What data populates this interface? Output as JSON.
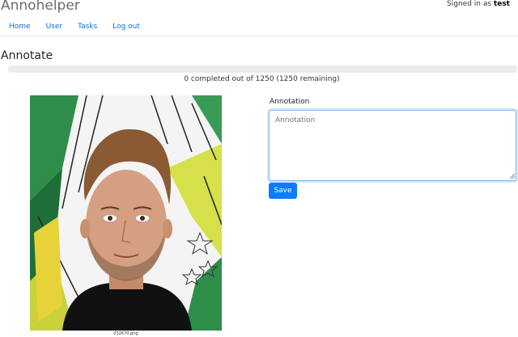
{
  "app": {
    "brand": "Annohelper"
  },
  "user": {
    "signed_in_prefix": "Signed in as",
    "username": "test"
  },
  "nav": {
    "items": [
      {
        "label": "Home"
      },
      {
        "label": "User"
      },
      {
        "label": "Tasks"
      },
      {
        "label": "Log out"
      }
    ]
  },
  "page": {
    "title": "Annotate"
  },
  "progress": {
    "completed": 0,
    "total": 1250,
    "fraction": 0,
    "text": "0 completed out of 1250 (1250 remaining)"
  },
  "image": {
    "caption": "032670.png"
  },
  "form": {
    "label": "Annotation",
    "placeholder": "Annotation",
    "value": "",
    "save_label": "Save"
  },
  "colors": {
    "accent": "#0b7bff",
    "link": "#0b6fd9",
    "progress_track": "#e9ecef"
  }
}
